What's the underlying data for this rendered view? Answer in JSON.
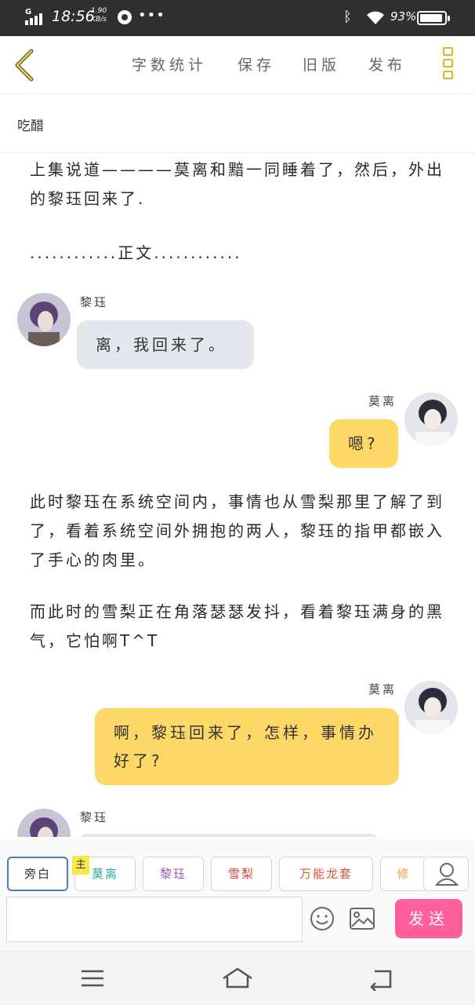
{
  "status_bar": {
    "network": "G",
    "time": "18:56",
    "speed_value": "1.90",
    "speed_unit": "KB/s",
    "battery": "93%"
  },
  "toolbar": {
    "word_count": "字数统计",
    "save": "保存",
    "old_version": "旧版",
    "publish": "发布"
  },
  "story_title": "吃醋",
  "narration": {
    "p1": "上集说道————莫离和黯一同睡着了，然后，外出的黎珏回来了.",
    "p2": "............正文............",
    "p3": "此时黎珏在系统空间内，事情也从雪梨那里了解了到了，看着系统空间外拥抱的两人，黎珏的指甲都嵌入了手心的肉里。",
    "p4": "而此时的雪梨正在角落瑟瑟发抖，看着黎珏满身的黑气，它怕啊T^T"
  },
  "messages": [
    {
      "speaker": "黎珏",
      "text": "离，我回来了。"
    },
    {
      "speaker": "莫离",
      "text": "嗯?"
    },
    {
      "speaker": "莫离",
      "text": "啊，黎珏回来了，怎样，事情办好了?"
    },
    {
      "speaker": "黎珏",
      "text": ""
    }
  ],
  "roles": {
    "narrator": "旁白",
    "host_tag": "主",
    "char1": "莫离",
    "char2": "黎珏",
    "char3": "雪梨",
    "char4": "万能龙套",
    "char5": "修"
  },
  "role_colors": {
    "narrator": "#333333",
    "char1": "#2aa9a5",
    "char2": "#9b59b6",
    "char3": "#d9443e",
    "char4": "#e0533a",
    "char5": "#f0a24a"
  },
  "input": {
    "value": "",
    "placeholder": ""
  },
  "send_label": "发送",
  "icons": {
    "back": "chevron-left-icon",
    "menu": "more-vertical-icon",
    "emoji": "emoji-icon",
    "image": "image-icon",
    "person": "person-icon"
  },
  "accent_colors": {
    "yellow": "#fdd866",
    "send": "#ff5f9b",
    "left_bubble": "#e3e7ee"
  }
}
